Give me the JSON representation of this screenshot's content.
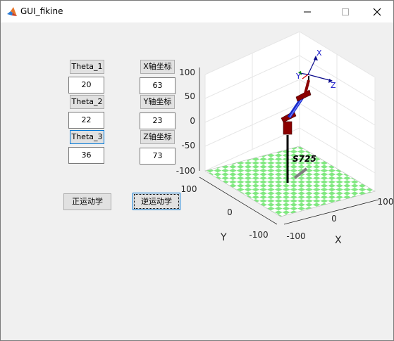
{
  "window": {
    "title": "GUI_fikine"
  },
  "controls": {
    "theta1_label": "Theta_1",
    "theta1_value": "20",
    "theta2_label": "Theta_2",
    "theta2_value": "22",
    "theta3_label": "Theta_3",
    "theta3_value": "36",
    "x_label": "X轴坐标",
    "x_value": "63",
    "y_label": "Y轴坐标",
    "y_value": "23",
    "z_label": "Z轴坐标",
    "z_value": "73",
    "forward_button": "正运动学",
    "inverse_button": "逆运动学"
  },
  "axes": {
    "z_ticks": [
      "100",
      "50",
      "0",
      "-50",
      "-100"
    ],
    "x_ticks": [
      "-100",
      "0",
      "100"
    ],
    "y_ticks": [
      "100",
      "0",
      "-100"
    ],
    "x_label": "X",
    "y_label": "Y",
    "model_label": "S725",
    "frame_labels": {
      "x": "X",
      "y": "Y",
      "z": "Z"
    }
  },
  "colors": {
    "floor_light": "#ffffff",
    "floor_green": "#80e880",
    "link": "#1428c8",
    "joint": "#8b0000"
  }
}
